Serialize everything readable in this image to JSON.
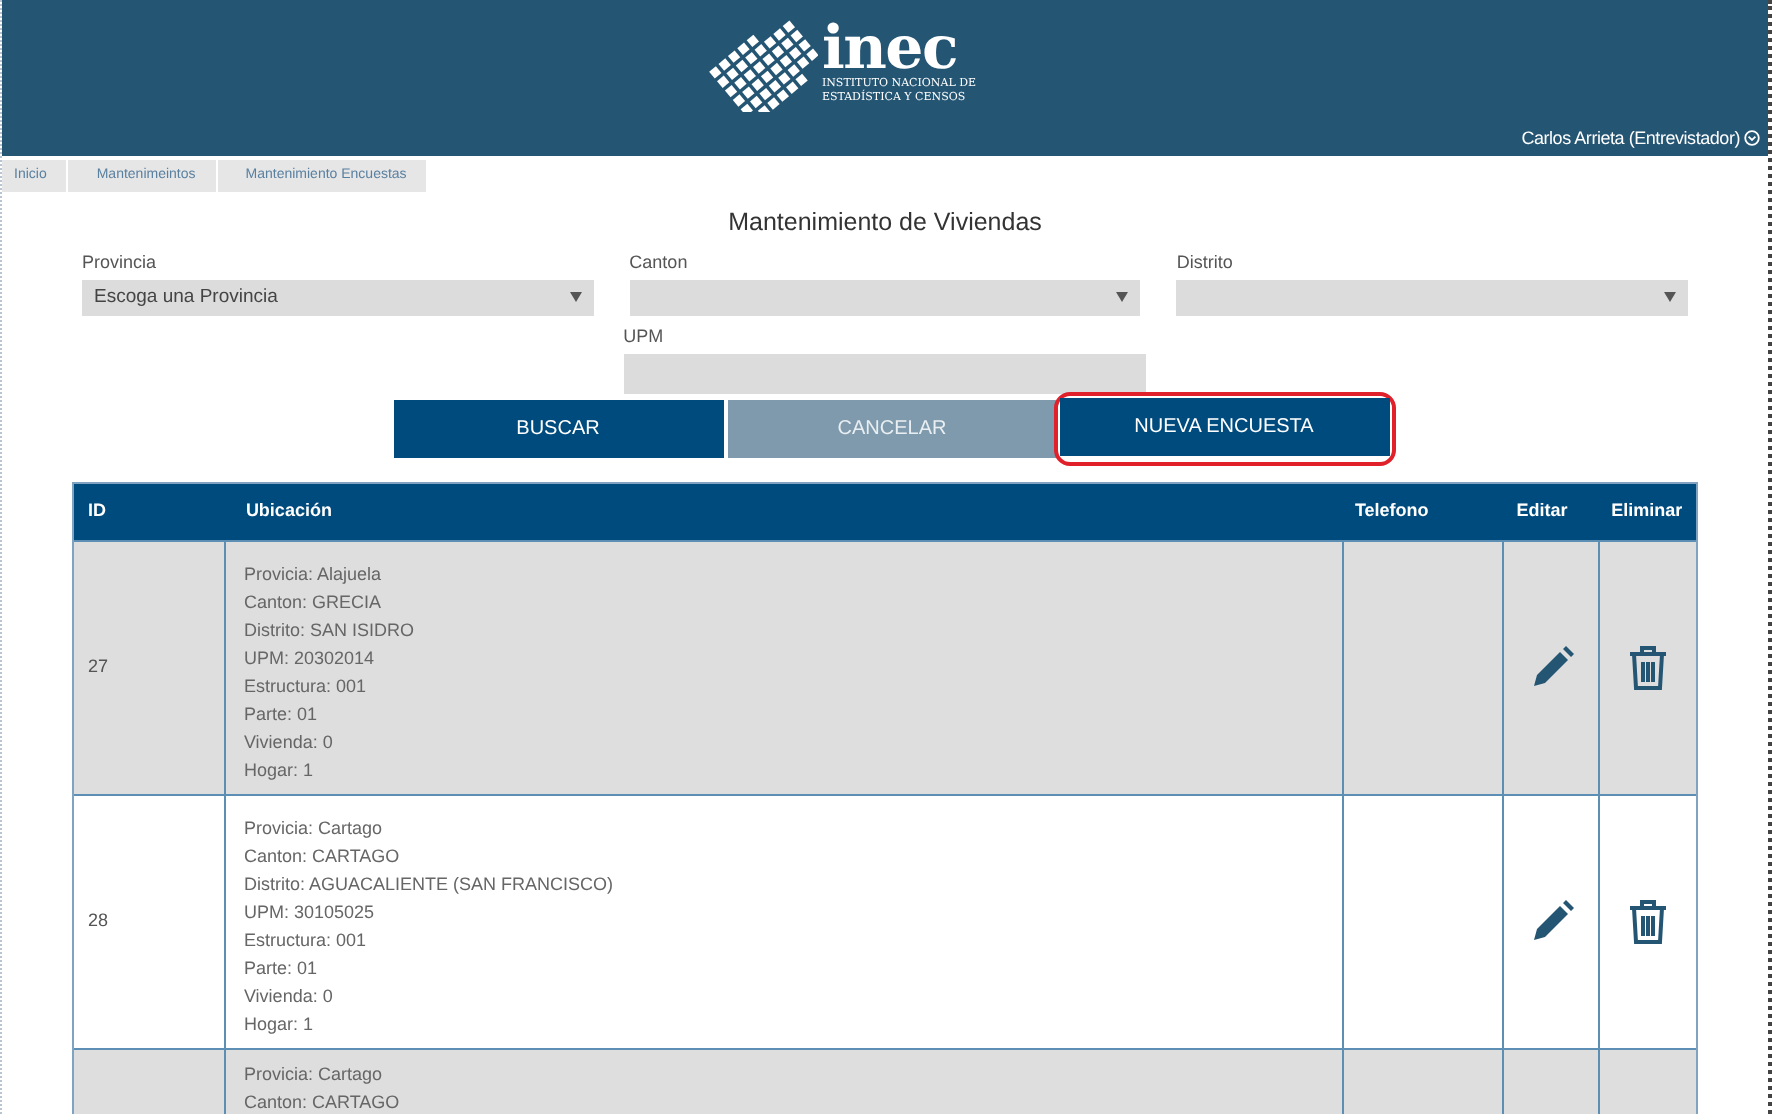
{
  "header": {
    "logo": {
      "wordmark": "inec",
      "subtitle_lines": [
        "INSTITUTO NACIONAL DE",
        "ESTADÍSTICA Y CENSOS"
      ]
    },
    "user": "Carlos Arrieta (Entrevistador)"
  },
  "breadcrumbs": [
    "Inicio",
    "Mantenimeintos",
    "Mantenimiento Encuestas"
  ],
  "title": "Mantenimiento de Viviendas",
  "filters": [
    {
      "label": "Provincia",
      "kind": "select",
      "value": "Escoga una Provincia"
    },
    {
      "label": "Canton",
      "kind": "select"
    },
    {
      "label": "Distrito",
      "kind": "select"
    },
    {
      "label": "UPM",
      "kind": "input"
    }
  ],
  "buttons": [
    {
      "label": "BUSCAR",
      "disabled": false,
      "highlighted": false
    },
    {
      "label": "CANCELAR",
      "disabled": true,
      "highlighted": false
    },
    {
      "label": "NUEVA ENCUESTA",
      "disabled": false,
      "highlighted": true
    }
  ],
  "table": {
    "columns": [
      "ID",
      "Ubicación",
      "Telefono",
      "Editar",
      "Eliminar"
    ],
    "rows": [
      {
        "id": "27",
        "lines": [
          "Provicia: Alajuela",
          "Canton: GRECIA",
          "Distrito: SAN ISIDRO",
          "UPM: 20302014",
          "Estructura: 001",
          "Parte: 01",
          "Vivienda: 0",
          "Hogar: 1"
        ]
      },
      {
        "id": "28",
        "lines": [
          "Provicia: Cartago",
          "Canton: CARTAGO",
          "Distrito: AGUACALIENTE (SAN FRANCISCO)",
          "UPM: 30105025",
          "Estructura: 001",
          "Parte: 01",
          "Vivienda: 0",
          "Hogar: 1"
        ]
      },
      {
        "lines": [
          "Provicia: Cartago",
          "Canton: CARTAGO"
        ]
      }
    ]
  }
}
